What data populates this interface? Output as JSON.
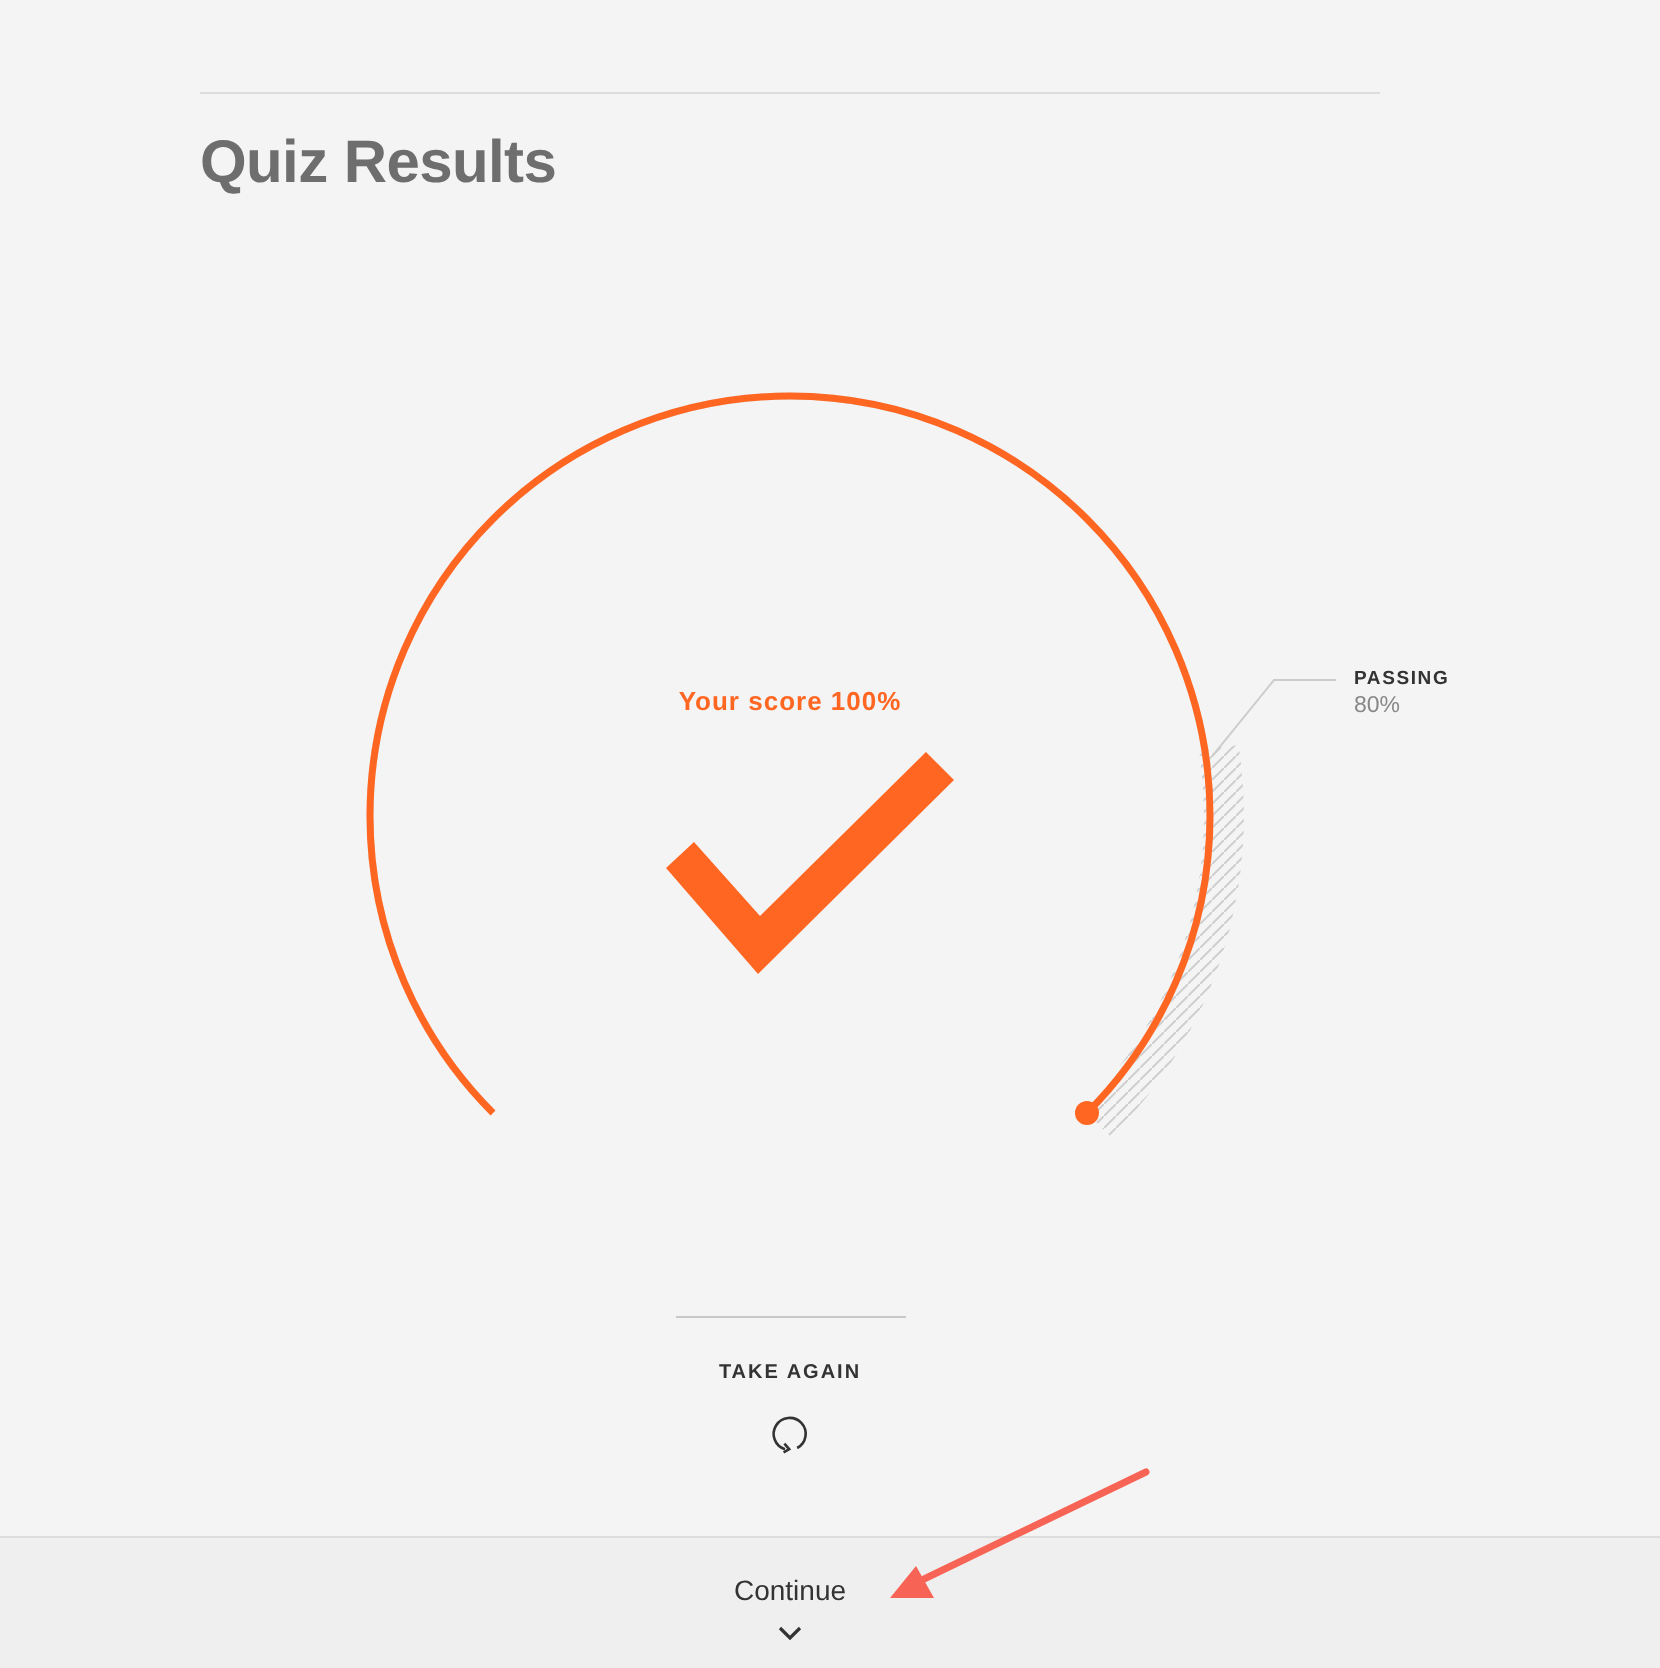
{
  "page": {
    "title": "Quiz Results"
  },
  "result": {
    "score_label": "Your score 100%",
    "level": 1,
    "passed": true,
    "passing": {
      "label": "PASSING",
      "value": "80%"
    }
  },
  "take_again": {
    "label": "TAKE AGAIN"
  },
  "footer": {
    "continue": {
      "label": "Continue"
    }
  }
}
